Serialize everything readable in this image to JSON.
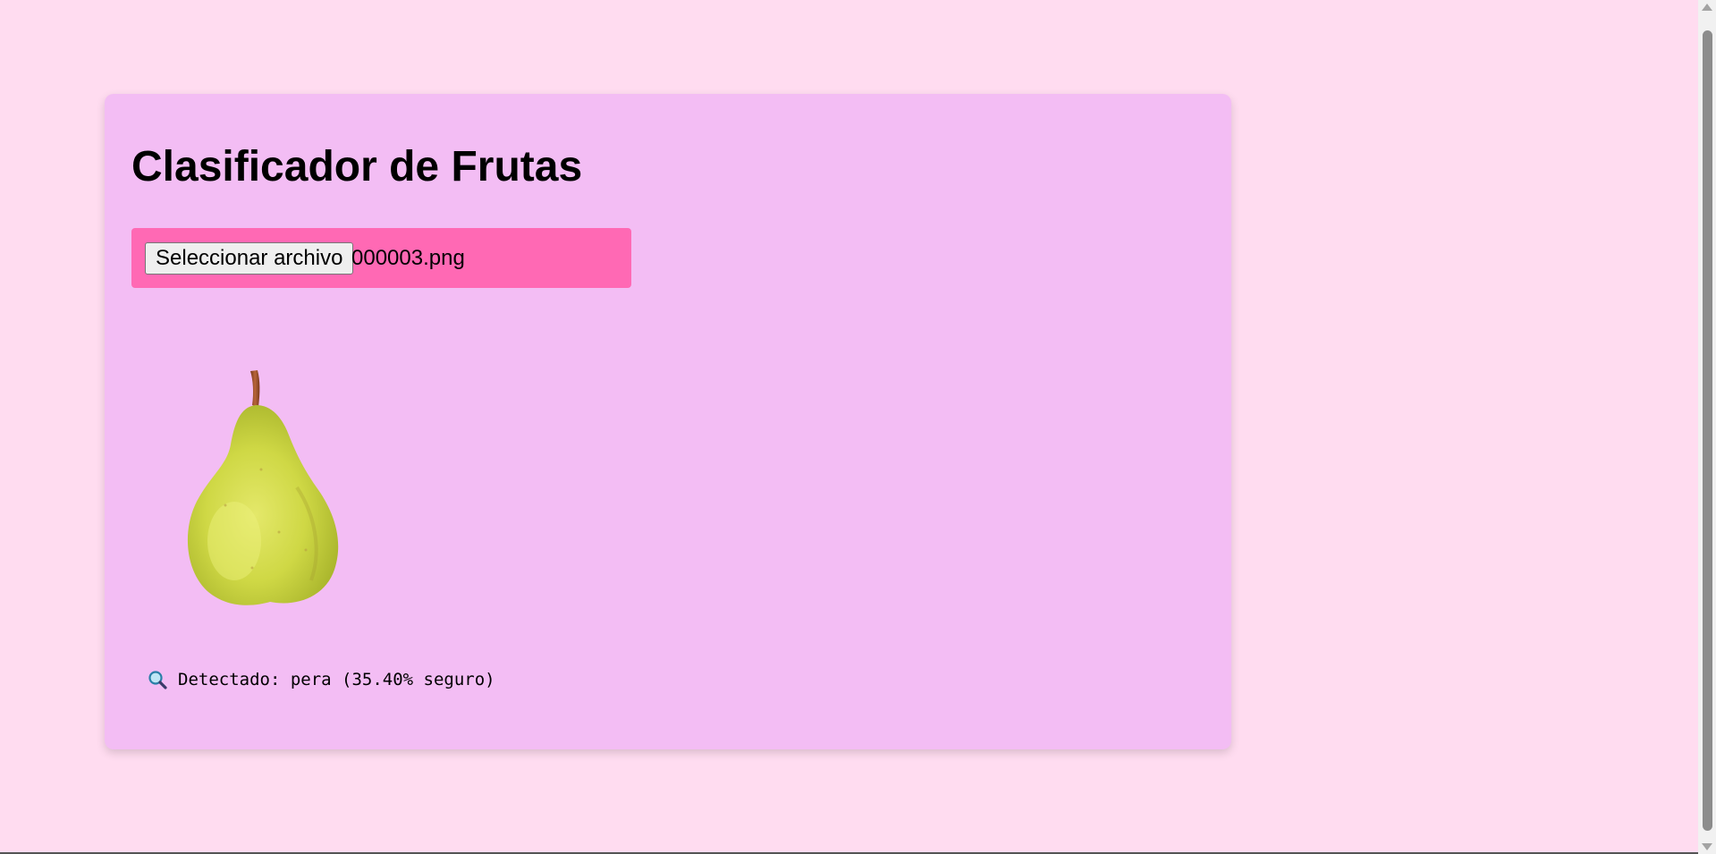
{
  "app": {
    "title": "Clasificador de Frutas"
  },
  "file_input": {
    "button_label": "Seleccionar archivo",
    "file_name": "000003.png"
  },
  "preview": {
    "subject": "pear"
  },
  "result": {
    "icon": "magnifier-icon",
    "text": "Detectado: pera (35.40% seguro)"
  },
  "colors": {
    "page_bg": "#ffdcf0",
    "card_bg": "#f3bdf4",
    "file_box_bg": "#ff69b4"
  }
}
